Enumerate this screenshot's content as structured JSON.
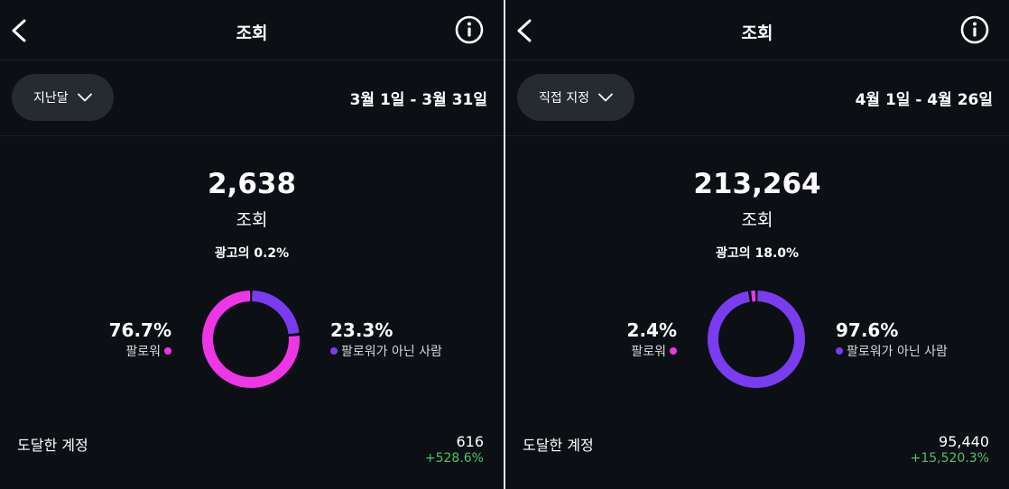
{
  "colors": {
    "followers": "#ee36e7",
    "non_followers": "#7a3cf0",
    "positive": "#4fc26a"
  },
  "panels": [
    {
      "header": {
        "title": "조회",
        "back_icon": "chevron-left-icon",
        "info_icon": "info-circle-icon"
      },
      "filter": {
        "label": "지난달",
        "icon": "chevron-down-icon"
      },
      "date_range": "3월 1일 - 3월 31일",
      "total": "2,638",
      "total_label": "조회",
      "ads": "광고의 0.2%",
      "followers": {
        "pct": "76.7%",
        "label": "팔로워",
        "value": 0.767
      },
      "non_followers": {
        "pct": "23.3%",
        "label": "팔로워가 아닌 사람",
        "value": 0.233
      },
      "reach": {
        "label": "도달한 계정",
        "value": "616",
        "change": "+528.6%"
      }
    },
    {
      "header": {
        "title": "조회",
        "back_icon": "chevron-left-icon",
        "info_icon": "info-circle-icon"
      },
      "filter": {
        "label": "직접 지정",
        "icon": "chevron-down-icon"
      },
      "date_range": "4월 1일 - 4월 26일",
      "total": "213,264",
      "total_label": "조회",
      "ads": "광고의 18.0%",
      "followers": {
        "pct": "2.4%",
        "label": "팔로워",
        "value": 0.024
      },
      "non_followers": {
        "pct": "97.6%",
        "label": "팔로워가 아닌 사람",
        "value": 0.976
      },
      "reach": {
        "label": "도달한 계정",
        "value": "95,440",
        "change": "+15,520.3%"
      }
    }
  ]
}
